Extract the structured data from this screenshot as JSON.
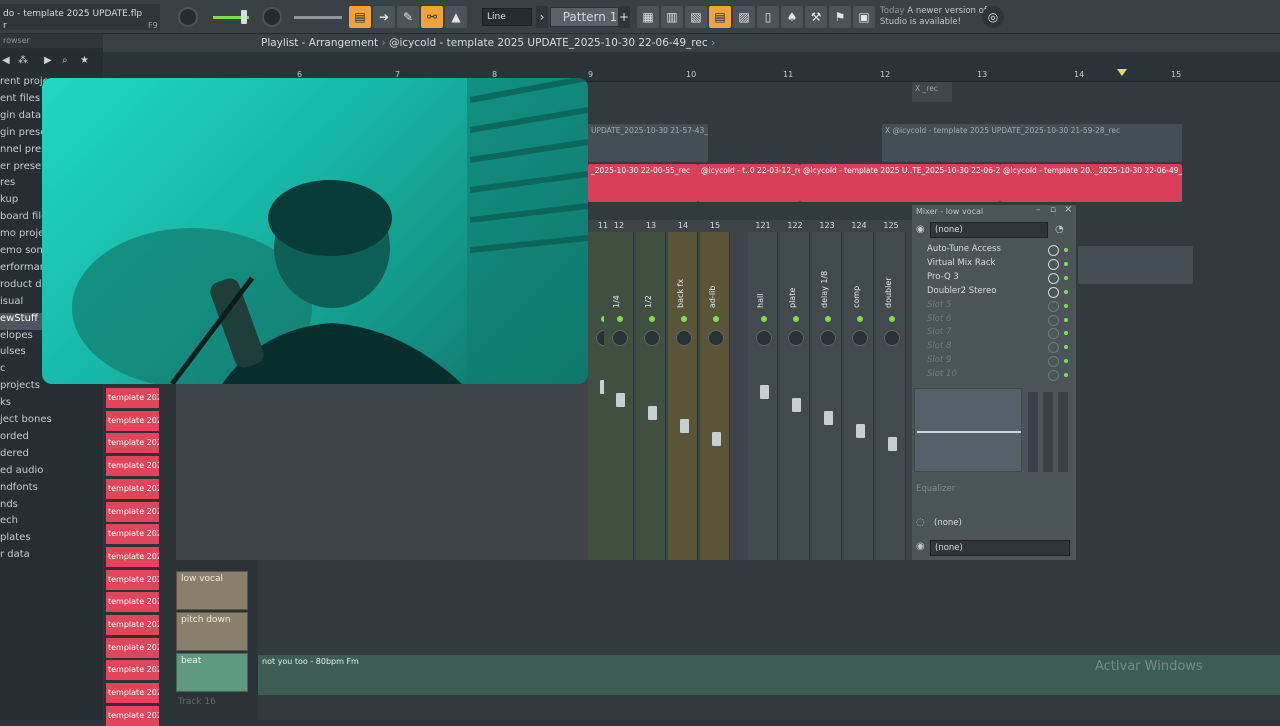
{
  "app": {
    "title": "do - template 2025 UPDATE.flp",
    "title_sub": "r",
    "shortcut": "F9",
    "line_mode": "Line",
    "pattern": "Pattern 1",
    "notice_today": "Today",
    "notice_text": "A newer version of FL Studio is available!"
  },
  "browser": {
    "header": "rowser",
    "items": [
      "rent proje",
      "ent files",
      "gin databa",
      "gin preset",
      "nnel prese",
      "er presets",
      "res",
      "kup",
      "board file",
      "mo project",
      "emo song",
      "erformanc",
      "roduct de",
      "isual",
      "ewStuff",
      "elopes",
      "ulses",
      "c",
      "projects",
      "ks",
      "ject bones",
      "orded",
      "dered",
      "ed audio",
      "ndfonts",
      "nds",
      "ech",
      "plates",
      "r data"
    ],
    "selected_index": 14
  },
  "playlist": {
    "breadcrumb": "Playlist - Arrangement",
    "project": "@icycold - template 2025 UPDATE_2025-10-30 22-06-49_rec",
    "timeline_numbers": [
      "6",
      "7",
      "8",
      "9",
      "10",
      "11",
      "12",
      "13",
      "14",
      "15"
    ],
    "clips": {
      "row1": "X _rec",
      "row2a": "UPDATE_2025-10-30 21-57-43_rec",
      "row2b": "X @icycold - template 2025 UPDATE_2025-10-30 21-59-28_rec",
      "row3a": "_2025-10-30 22-00-55_rec",
      "row3b": "@icycold - t..0 22-03-12_rec",
      "row3c": "@icycold - template 2025 U..TE_2025-10-30 22-06-24_rec",
      "row3d": "@icycold - template 20.._2025-10-30 22-06-49_rec"
    },
    "pattern_block_label": "template 202..",
    "tracks": [
      "low vocal",
      "pitch down",
      "beat",
      "Track 16"
    ],
    "beat_clip": "not you too - 80bpm Fm"
  },
  "mixer": {
    "window_title": "Mixer - low vocal",
    "channel_numbers": [
      "11",
      "12",
      "13",
      "14",
      "15",
      "121",
      "122",
      "123",
      "124",
      "125"
    ],
    "channel_names": [
      "",
      "1/4",
      "1/2",
      "back fx",
      "ad-lib",
      "hall",
      "plate",
      "delay 1/8",
      "comp",
      "doubler"
    ],
    "fx_select": "(none)",
    "fx_slots": [
      "Auto-Tune Access",
      "Virtual Mix Rack",
      "Pro-Q 3",
      "Doubler2 Stereo",
      "Slot 5",
      "Slot 6",
      "Slot 7",
      "Slot 8",
      "Slot 9",
      "Slot 10"
    ],
    "eq_label": "Equalizer",
    "out1": "(none)",
    "out2": "(none)"
  },
  "os": {
    "watermark": "Activar Windows"
  },
  "colors": {
    "accent_orange": "#f0a33a",
    "clip_red": "#d8405a",
    "pattern_red": "#e0455b",
    "mixer_bg": "#3c4449",
    "green_level": "#7fe04e"
  }
}
